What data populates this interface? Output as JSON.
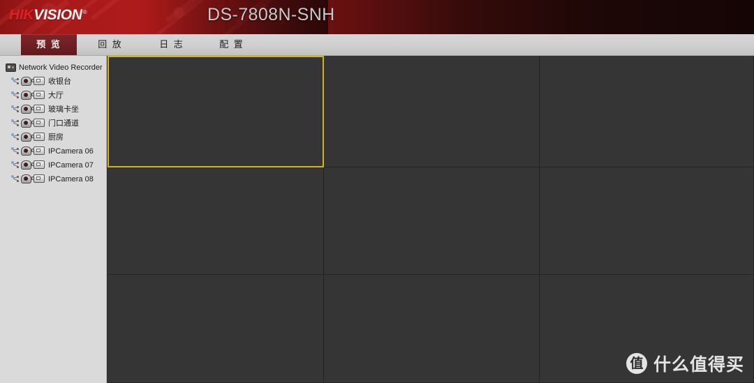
{
  "header": {
    "brand_hik": "HIK",
    "brand_vision": "VISION",
    "brand_tm": "®",
    "device_title": "DS-7808N-SNH",
    "brand_red": "#e01f26",
    "header_red": "#ae1b1b"
  },
  "tabs": [
    {
      "label": "预 览",
      "active": true
    },
    {
      "label": "回 放",
      "active": false
    },
    {
      "label": "日 志",
      "active": false
    },
    {
      "label": "配 置",
      "active": false
    }
  ],
  "sidebar": {
    "root": {
      "label": "Network Video Recorder",
      "icon": "nvr-icon"
    },
    "items": [
      {
        "label": "收银台",
        "icons": [
          "network-node-icon",
          "dome-camera-icon",
          "camcorder-icon"
        ]
      },
      {
        "label": "大厅",
        "icons": [
          "network-node-icon",
          "dome-camera-icon",
          "camcorder-icon"
        ]
      },
      {
        "label": "玻璃卡坐",
        "icons": [
          "network-node-icon",
          "dome-camera-icon",
          "camcorder-icon"
        ]
      },
      {
        "label": "门口通道",
        "icons": [
          "network-node-icon",
          "dome-camera-icon",
          "camcorder-icon"
        ]
      },
      {
        "label": "厨房",
        "icons": [
          "network-node-icon",
          "dome-camera-icon",
          "camcorder-icon"
        ]
      },
      {
        "label": "IPCamera 06",
        "icons": [
          "network-node-icon",
          "dome-camera-icon",
          "camcorder-icon"
        ]
      },
      {
        "label": "IPCamera 07",
        "icons": [
          "network-node-icon",
          "dome-camera-icon",
          "camcorder-icon"
        ]
      },
      {
        "label": "IPCamera 08",
        "icons": [
          "network-node-icon",
          "dome-camera-icon",
          "camcorder-icon"
        ]
      }
    ]
  },
  "video_grid": {
    "layout": "3x3",
    "selected_cell": 0,
    "selection_color": "#d4b41e",
    "cell_background": "#353535",
    "cells": [
      {
        "index": 0,
        "label": ""
      },
      {
        "index": 1,
        "label": ""
      },
      {
        "index": 2,
        "label": ""
      },
      {
        "index": 3,
        "label": ""
      },
      {
        "index": 4,
        "label": ""
      },
      {
        "index": 5,
        "label": ""
      },
      {
        "index": 6,
        "label": ""
      },
      {
        "index": 7,
        "label": ""
      },
      {
        "index": 8,
        "label": ""
      }
    ]
  },
  "watermark": {
    "badge": "值",
    "text": "什么值得买"
  }
}
